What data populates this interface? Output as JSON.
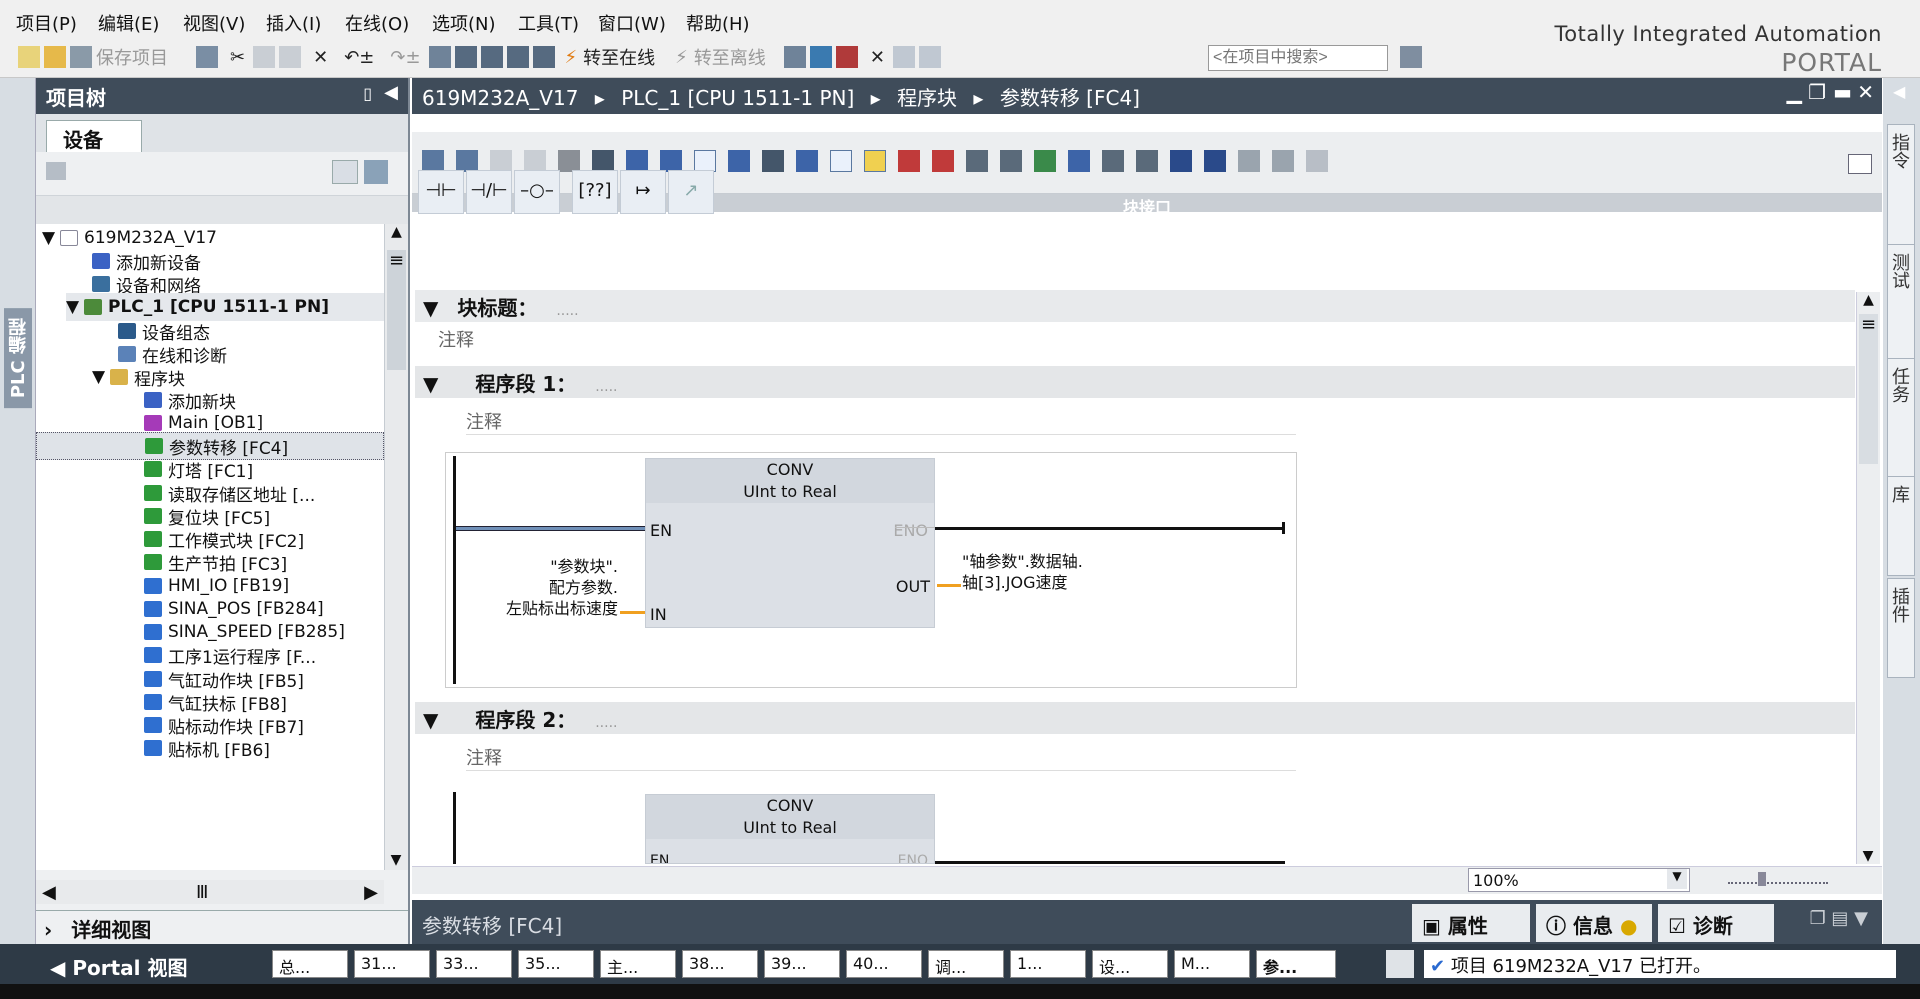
{
  "menu": {
    "items": [
      "项目(P)",
      "编辑(E)",
      "视图(V)",
      "插入(I)",
      "在线(O)",
      "选项(N)",
      "工具(T)",
      "窗口(W)",
      "帮助(H)"
    ]
  },
  "brand": {
    "line1": "Totally Integrated Automation",
    "line2": "PORTAL"
  },
  "toolbar": {
    "save_project": "保存项目",
    "go_online": "转至在线",
    "go_offline": "转至离线"
  },
  "search": {
    "placeholder": "<在项目中搜索>"
  },
  "left_strip": {
    "label": "PLC 编程"
  },
  "project_tree": {
    "title": "项目树",
    "tab_devices": "设备",
    "items": [
      {
        "label": "619M232A_V17"
      },
      {
        "label": "添加新设备"
      },
      {
        "label": "设备和网络"
      },
      {
        "label": "PLC_1 [CPU 1511-1 PN]"
      },
      {
        "label": "设备组态"
      },
      {
        "label": "在线和诊断"
      },
      {
        "label": "程序块"
      },
      {
        "label": "添加新块"
      },
      {
        "label": "Main [OB1]"
      },
      {
        "label": "参数转移 [FC4]"
      },
      {
        "label": "灯塔 [FC1]"
      },
      {
        "label": "读取存储区地址 [..."
      },
      {
        "label": "复位块 [FC5]"
      },
      {
        "label": "工作模式块 [FC2]"
      },
      {
        "label": "生产节拍 [FC3]"
      },
      {
        "label": "HMI_IO [FB19]"
      },
      {
        "label": "SINA_POS [FB284]"
      },
      {
        "label": "SINA_SPEED [FB285]"
      },
      {
        "label": "工序1运行程序 [F..."
      },
      {
        "label": "气缸动作块 [FB5]"
      },
      {
        "label": "气缸扶标 [FB8]"
      },
      {
        "label": "贴标动作块 [FB7]"
      },
      {
        "label": "贴标机 [FB6]"
      }
    ],
    "detail_view": "详细视图"
  },
  "editor": {
    "breadcrumb": [
      "619M232A_V17",
      "PLC_1 [CPU 1511-1 PN]",
      "程序块",
      "参数转移 [FC4]"
    ],
    "interface_label": "块接口",
    "block_title_label": "块标题：",
    "dots": ".....",
    "comment": "注释",
    "network1_title": "程序段 1：",
    "network2_title": "程序段 2：",
    "conv": {
      "name": "CONV",
      "from": "UInt",
      "to_word": "to",
      "to": "Real",
      "en": "EN",
      "eno": "ENO",
      "out": "OUT",
      "in": "IN"
    },
    "in_operand": [
      "\"参数块\".",
      "配方参数.",
      "左贴标出标速度"
    ],
    "out_operand": [
      "\"轴参数\".数据轴.",
      "轴[3].JOG速度"
    ],
    "zoom": "100%"
  },
  "right_tabs": [
    "指令",
    "测试",
    "任务",
    "库",
    "插件"
  ],
  "inspector": {
    "title": "参数转移 [FC4]",
    "properties": "属性",
    "info": "信息",
    "diagnostics": "诊断"
  },
  "taskbar": {
    "portal_view": "Portal 视图",
    "items": [
      "总...",
      "31...",
      "33...",
      "35...",
      "主...",
      "38...",
      "39...",
      "40...",
      "调...",
      "1...",
      "设...",
      "M...",
      "参..."
    ],
    "status": "项目 619M232A_V17 已打开。"
  }
}
